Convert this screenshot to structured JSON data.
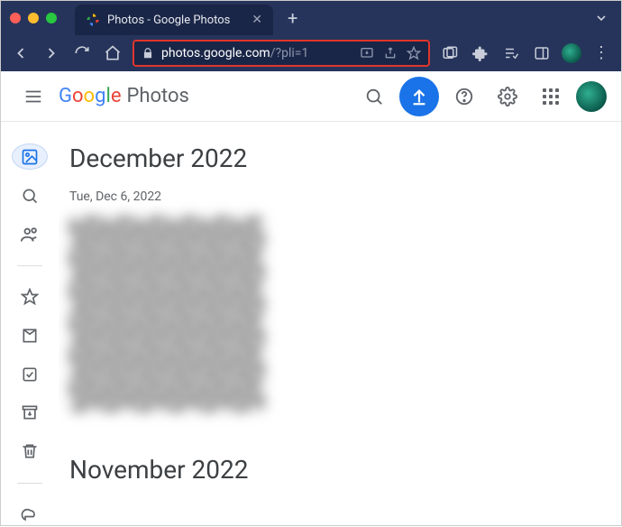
{
  "browser": {
    "tab_title": "Photos - Google Photos",
    "url_host": "photos.google.com",
    "url_path": "/?pli=1"
  },
  "header": {
    "logo_text": "Photos"
  },
  "content": {
    "month1_title": "December 2022",
    "month1_date": "Tue, Dec 6, 2022",
    "month2_title": "November 2022"
  }
}
